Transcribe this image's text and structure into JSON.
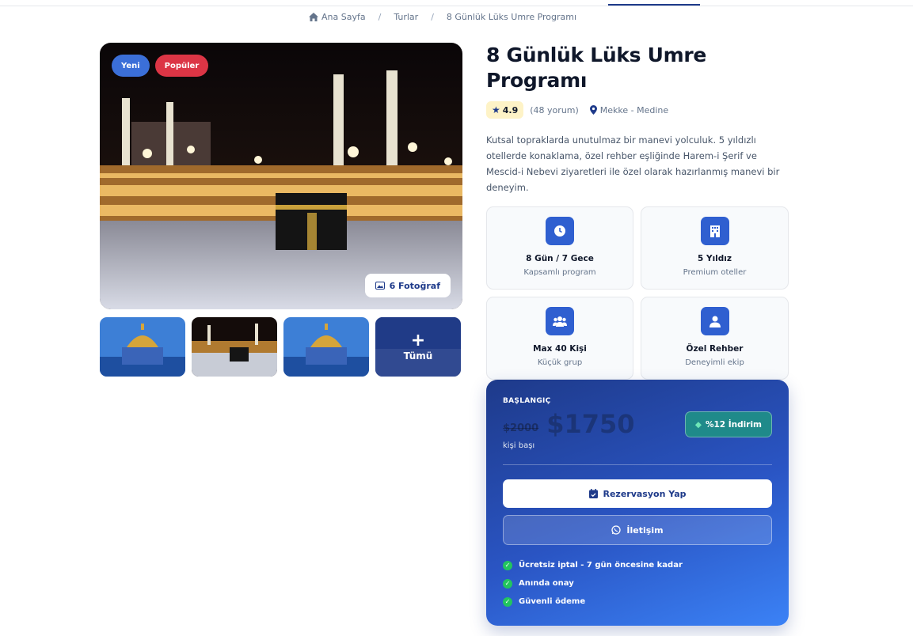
{
  "breadcrumb": {
    "home": "Ana Sayfa",
    "tours": "Turlar",
    "current": "8 Günlük Lüks Umre Programı",
    "separator": "/"
  },
  "gallery": {
    "badges": {
      "new": "Yeni",
      "popular": "Popüler"
    },
    "photo_count": "6 Fotoğraf",
    "more_label": "Tümü",
    "more_icon": "+"
  },
  "tour": {
    "title": "8 Günlük Lüks Umre Programı",
    "rating": "4.9",
    "reviews": "(48 yorum)",
    "location": "Mekke - Medine",
    "description": "Kutsal topraklarda unutulmaz bir manevi yolculuk. 5 yıldızlı otellerde konaklama, özel rehber eşliğinde Harem-i Şerif ve Mescid-i Nebevi ziyaretleri ile özel olarak hazırlanmış manevi bir deneyim."
  },
  "features": [
    {
      "title": "8 Gün / 7 Gece",
      "subtitle": "Kapsamlı program",
      "icon": "clock-icon"
    },
    {
      "title": "5 Yıldız",
      "subtitle": "Premium oteller",
      "icon": "hotel-icon"
    },
    {
      "title": "Max 40 Kişi",
      "subtitle": "Küçük grup",
      "icon": "users-icon"
    },
    {
      "title": "Özel Rehber",
      "subtitle": "Deneyimli ekip",
      "icon": "guide-icon"
    }
  ],
  "pricing": {
    "start_label": "BAŞLANGIÇ",
    "old_price": "$2000",
    "new_price": "$1750",
    "per_person": "kişi başı",
    "discount": "%12 İndirim",
    "book_button": "Rezervasyon Yap",
    "contact_button": "İletişim",
    "benefits": [
      "Ücretsiz iptal - 7 gün öncesine kadar",
      "Anında onay",
      "Güvenli ödeme"
    ]
  },
  "colors": {
    "primary": "#1e3a8a",
    "accent": "#2f5fd0",
    "badge_new": "#3b6fd8",
    "badge_popular": "#dc3545",
    "check": "#22c55e"
  }
}
